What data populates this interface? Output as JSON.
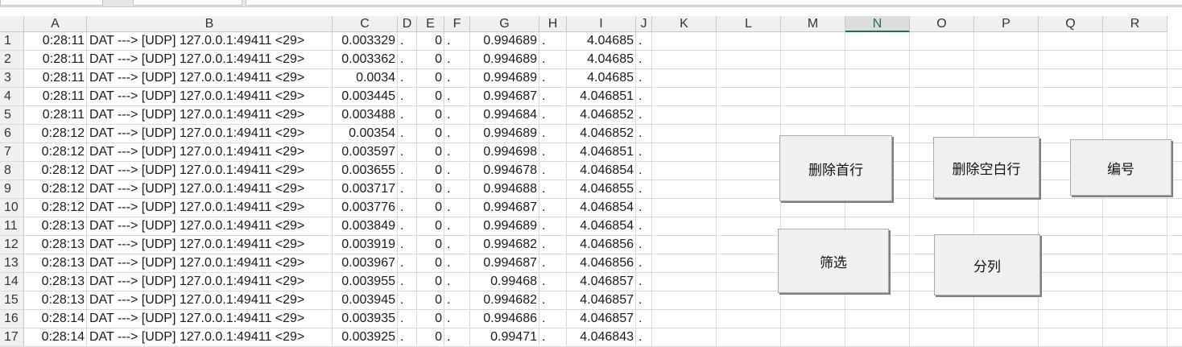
{
  "columns": [
    "A",
    "B",
    "C",
    "D",
    "E",
    "F",
    "G",
    "H",
    "I",
    "J",
    "K",
    "L",
    "M",
    "N",
    "O",
    "P",
    "Q",
    "R"
  ],
  "selected_column": "N",
  "rows": [
    {
      "n": "1",
      "a": "0:28:11",
      "b": "DAT ---> [UDP] 127.0.0.1:49411 <29>",
      "c": "0.003329",
      "d": ".",
      "e": "0",
      "f": ".",
      "g": "0.994689",
      "h": ".",
      "i": "4.04685",
      "j": "."
    },
    {
      "n": "2",
      "a": "0:28:11",
      "b": "DAT ---> [UDP] 127.0.0.1:49411 <29>",
      "c": "0.003362",
      "d": ".",
      "e": "0",
      "f": ".",
      "g": "0.994689",
      "h": ".",
      "i": "4.04685",
      "j": "."
    },
    {
      "n": "3",
      "a": "0:28:11",
      "b": "DAT ---> [UDP] 127.0.0.1:49411 <29>",
      "c": "0.0034",
      "d": ".",
      "e": "0",
      "f": ".",
      "g": "0.994689",
      "h": ".",
      "i": "4.04685",
      "j": "."
    },
    {
      "n": "4",
      "a": "0:28:11",
      "b": "DAT ---> [UDP] 127.0.0.1:49411 <29>",
      "c": "0.003445",
      "d": ".",
      "e": "0",
      "f": ".",
      "g": "0.994687",
      "h": ".",
      "i": "4.046851",
      "j": "."
    },
    {
      "n": "5",
      "a": "0:28:11",
      "b": "DAT ---> [UDP] 127.0.0.1:49411 <29>",
      "c": "0.003488",
      "d": ".",
      "e": "0",
      "f": ".",
      "g": "0.994684",
      "h": ".",
      "i": "4.046852",
      "j": "."
    },
    {
      "n": "6",
      "a": "0:28:12",
      "b": "DAT ---> [UDP] 127.0.0.1:49411 <29>",
      "c": "0.00354",
      "d": ".",
      "e": "0",
      "f": ".",
      "g": "0.994689",
      "h": ".",
      "i": "4.046852",
      "j": "."
    },
    {
      "n": "7",
      "a": "0:28:12",
      "b": "DAT ---> [UDP] 127.0.0.1:49411 <29>",
      "c": "0.003597",
      "d": ".",
      "e": "0",
      "f": ".",
      "g": "0.994698",
      "h": ".",
      "i": "4.046851",
      "j": "."
    },
    {
      "n": "8",
      "a": "0:28:12",
      "b": "DAT ---> [UDP] 127.0.0.1:49411 <29>",
      "c": "0.003655",
      "d": ".",
      "e": "0",
      "f": ".",
      "g": "0.994678",
      "h": ".",
      "i": "4.046854",
      "j": "."
    },
    {
      "n": "9",
      "a": "0:28:12",
      "b": "DAT ---> [UDP] 127.0.0.1:49411 <29>",
      "c": "0.003717",
      "d": ".",
      "e": "0",
      "f": ".",
      "g": "0.994688",
      "h": ".",
      "i": "4.046855",
      "j": "."
    },
    {
      "n": "10",
      "a": "0:28:12",
      "b": "DAT ---> [UDP] 127.0.0.1:49411 <29>",
      "c": "0.003776",
      "d": ".",
      "e": "0",
      "f": ".",
      "g": "0.994687",
      "h": ".",
      "i": "4.046854",
      "j": "."
    },
    {
      "n": "11",
      "a": "0:28:13",
      "b": "DAT ---> [UDP] 127.0.0.1:49411 <29>",
      "c": "0.003849",
      "d": ".",
      "e": "0",
      "f": ".",
      "g": "0.994689",
      "h": ".",
      "i": "4.046854",
      "j": "."
    },
    {
      "n": "12",
      "a": "0:28:13",
      "b": "DAT ---> [UDP] 127.0.0.1:49411 <29>",
      "c": "0.003919",
      "d": ".",
      "e": "0",
      "f": ".",
      "g": "0.994682",
      "h": ".",
      "i": "4.046856",
      "j": "."
    },
    {
      "n": "13",
      "a": "0:28:13",
      "b": "DAT ---> [UDP] 127.0.0.1:49411 <29>",
      "c": "0.003967",
      "d": ".",
      "e": "0",
      "f": ".",
      "g": "0.994687",
      "h": ".",
      "i": "4.046856",
      "j": "."
    },
    {
      "n": "14",
      "a": "0:28:13",
      "b": "DAT ---> [UDP] 127.0.0.1:49411 <29>",
      "c": "0.003955",
      "d": ".",
      "e": "0",
      "f": ".",
      "g": "0.99468",
      "h": ".",
      "i": "4.046857",
      "j": "."
    },
    {
      "n": "15",
      "a": "0:28:13",
      "b": "DAT ---> [UDP] 127.0.0.1:49411 <29>",
      "c": "0.003945",
      "d": ".",
      "e": "0",
      "f": ".",
      "g": "0.994682",
      "h": ".",
      "i": "4.046857",
      "j": "."
    },
    {
      "n": "16",
      "a": "0:28:14",
      "b": "DAT ---> [UDP] 127.0.0.1:49411 <29>",
      "c": "0.003935",
      "d": ".",
      "e": "0",
      "f": ".",
      "g": "0.994686",
      "h": ".",
      "i": "4.046857",
      "j": "."
    },
    {
      "n": "17",
      "a": "0:28:14",
      "b": "DAT ---> [UDP] 127.0.0.1:49411 <29>",
      "c": "0.003925",
      "d": ".",
      "e": "0",
      "f": ".",
      "g": "0.99471",
      "h": ".",
      "i": "4.046843",
      "j": "."
    }
  ],
  "buttons": {
    "delete_first_row": "删除首行",
    "delete_blank_rows": "删除空白行",
    "numbering": "编号",
    "filter": "筛选",
    "split_columns": "分列"
  }
}
